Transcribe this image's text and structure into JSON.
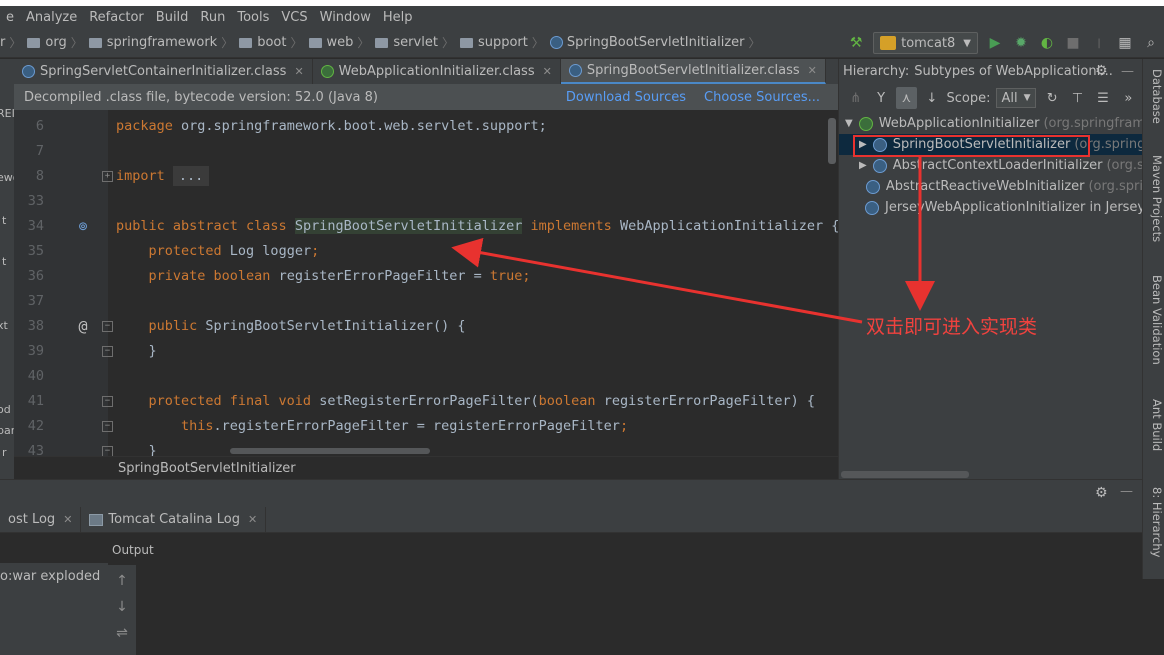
{
  "menu": {
    "items": [
      "e",
      "Analyze",
      "Refactor",
      "Build",
      "Run",
      "Tools",
      "VCS",
      "Window",
      "Help"
    ],
    "underline": [
      "",
      "A",
      "R",
      "B",
      "u",
      "T",
      "S",
      "W",
      "H"
    ]
  },
  "navbar": {
    "crumbs": [
      "r",
      "org",
      "springframework",
      "boot",
      "web",
      "servlet",
      "support"
    ],
    "file": "SpringBootServletInitializer",
    "run_config": "tomcat8"
  },
  "tabs": [
    {
      "label": "SpringServletContainerInitializer.class",
      "icon": "class-icon",
      "active": false
    },
    {
      "label": "WebApplicationInitializer.class",
      "icon": "interface-icon",
      "active": false
    },
    {
      "label": "SpringBootServletInitializer.class",
      "icon": "class-icon",
      "active": true
    }
  ],
  "banner": {
    "text": "Decompiled .class file, bytecode version: 52.0 (Java 8)",
    "download_sources": "Download Sources",
    "choose_sources": "Choose Sources..."
  },
  "left_strip_fragments": [
    "REI",
    "ewo",
    "t",
    "t",
    "xt",
    "od",
    "bar",
    "r"
  ],
  "code_lines": [
    {
      "n": "6",
      "parts": [
        [
          "kw",
          "package "
        ],
        [
          "",
          "org.springframework.boot.web.servlet.support;"
        ]
      ]
    },
    {
      "n": "7",
      "parts": []
    },
    {
      "n": "8",
      "parts": [
        [
          "kw",
          "import "
        ],
        [
          "fold",
          "..."
        ]
      ]
    },
    {
      "n": "33",
      "parts": []
    },
    {
      "n": "34",
      "parts": [
        [
          "kw",
          "public abstract class "
        ],
        [
          "hl",
          "SpringBootServletInitializer"
        ],
        [
          "kw",
          " implements "
        ],
        [
          "",
          "WebApplicationInitializer {"
        ]
      ]
    },
    {
      "n": "35",
      "parts": [
        [
          "kw",
          "    protected "
        ],
        [
          "",
          "Log logger"
        ],
        [
          "kw",
          ";"
        ]
      ]
    },
    {
      "n": "36",
      "parts": [
        [
          "kw",
          "    private boolean "
        ],
        [
          "",
          "registerErrorPageFilter = "
        ],
        [
          "kw",
          "true;"
        ]
      ]
    },
    {
      "n": "37",
      "parts": []
    },
    {
      "n": "38",
      "parts": [
        [
          "kw",
          "    public "
        ],
        [
          "",
          "SpringBootServletInitializer() {"
        ]
      ]
    },
    {
      "n": "39",
      "parts": [
        [
          "",
          "    }"
        ]
      ]
    },
    {
      "n": "40",
      "parts": []
    },
    {
      "n": "41",
      "parts": [
        [
          "kw",
          "    protected final void "
        ],
        [
          "",
          "setRegisterErrorPageFilter("
        ],
        [
          "kw",
          "boolean "
        ],
        [
          "",
          "registerErrorPageFilter) {"
        ]
      ]
    },
    {
      "n": "42",
      "parts": [
        [
          "kw",
          "        this"
        ],
        [
          "",
          ".registerErrorPageFilter = registerErrorPageFilter"
        ],
        [
          "kw",
          ";"
        ]
      ]
    },
    {
      "n": "43",
      "parts": [
        [
          "",
          "    }"
        ]
      ]
    }
  ],
  "editor_breadcrumb": "SpringBootServletInitializer",
  "hierarchy": {
    "title": "Hierarchy:",
    "subtitle": "Subtypes of WebApplicationI...",
    "scope_label": "Scope:",
    "scope_value": "All",
    "tree": [
      {
        "name": "WebApplicationInitializer",
        "pkg": "(org.springfram",
        "arrow": "▼",
        "icon": "interface-icon",
        "indent": 0,
        "selected": false
      },
      {
        "name": "SpringBootServletInitializer",
        "pkg": "(org.springf",
        "arrow": "▶",
        "icon": "class-icon",
        "indent": 1,
        "selected": true
      },
      {
        "name": "AbstractContextLoaderInitializer",
        "pkg": "(org.sp",
        "arrow": "▶",
        "icon": "class-icon",
        "indent": 1,
        "selected": false
      },
      {
        "name": "AbstractReactiveWebInitializer",
        "pkg": "(org.spri",
        "arrow": "",
        "icon": "class-icon",
        "indent": 1,
        "selected": false
      },
      {
        "name": "JerseyWebApplicationInitializer in Jersey",
        "pkg": "",
        "arrow": "",
        "icon": "class-icon",
        "indent": 1,
        "selected": false
      }
    ]
  },
  "right_stripe": [
    "Database",
    "Maven Projects",
    "Bean Validation",
    "Ant Build",
    "8: Hierarchy"
  ],
  "bottom": {
    "tabs": [
      {
        "label": "ost Log"
      },
      {
        "label": "Tomcat Catalina Log"
      }
    ],
    "output_label": "Output",
    "deploy_item": "o:war exploded"
  },
  "annotation": {
    "text": "双击即可进入实现类",
    "color": "#e8322f"
  },
  "colors": {
    "keyword": "#cc7832",
    "identifier": "#a9b7c6",
    "link": "#589df6",
    "selection": "#0d293e"
  }
}
